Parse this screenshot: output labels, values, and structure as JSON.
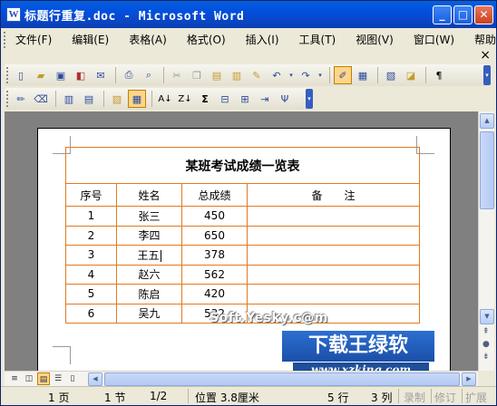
{
  "window": {
    "title": "标题行重复.doc - Microsoft Word",
    "app_icon": "W",
    "min_label": "_",
    "max_label": "□",
    "close_label": "✕"
  },
  "menu": {
    "items": [
      "文件(F)",
      "编辑(E)",
      "表格(A)",
      "格式(O)",
      "插入(I)",
      "工具(T)",
      "视图(V)",
      "窗口(W)",
      "帮助(H)"
    ],
    "doc_close": "×"
  },
  "table": {
    "title": "某班考试成绩一览表",
    "headers": [
      "序号",
      "姓名",
      "总成绩",
      "备　　注"
    ],
    "rows": [
      [
        "1",
        "张三",
        "450",
        ""
      ],
      [
        "2",
        "李四",
        "650",
        ""
      ],
      [
        "3",
        "王五",
        "378",
        ""
      ],
      [
        "4",
        "赵六",
        "562",
        ""
      ],
      [
        "5",
        "陈启",
        "420",
        ""
      ],
      [
        "6",
        "吴九",
        "532",
        ""
      ]
    ]
  },
  "watermark": {
    "site": "Soft.Yesky.c@m",
    "brand": "下载王绿软",
    "url": "www.xzking.com"
  },
  "status": {
    "page": "1 页",
    "section": "1 节",
    "page_of": "1/2",
    "position": "位置 3.8厘米",
    "line": "5 行",
    "column": "3 列",
    "rec": "录制",
    "trk": "修订",
    "ext": "扩展"
  },
  "colors": {
    "title_bar": "#0a4fd0",
    "table_border": "#e07b22",
    "workspace": "#808080"
  }
}
